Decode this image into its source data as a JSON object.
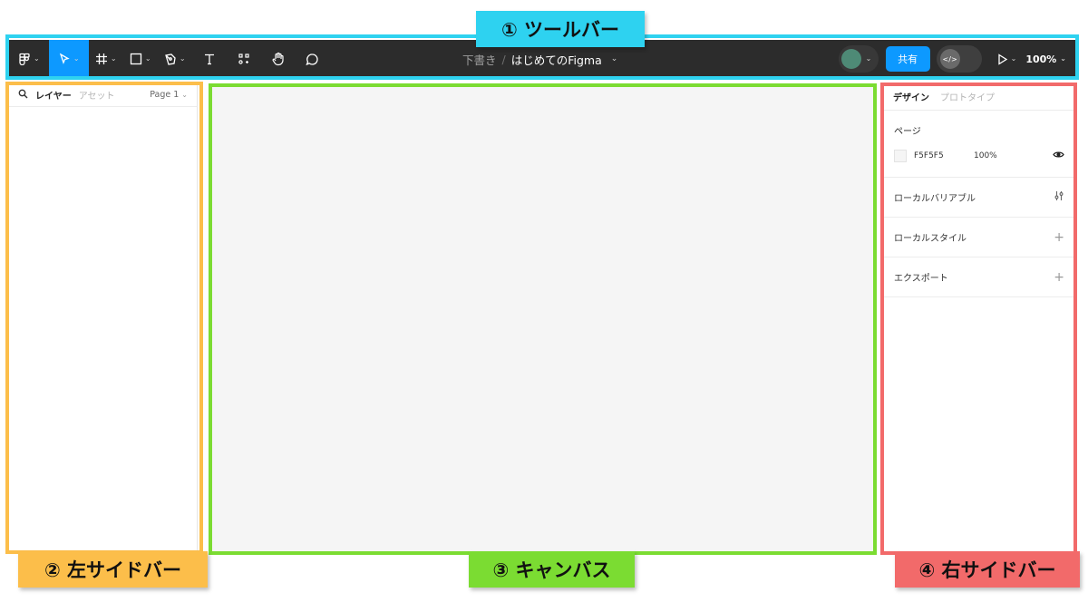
{
  "annotations": {
    "toolbar": "① ツールバー",
    "left_sidebar": "② 左サイドバー",
    "canvas": "③ キャンバス",
    "right_sidebar": "④ 右サイドバー",
    "colors": {
      "toolbar": "#2ed2f0",
      "left_sidebar": "#fcbe4a",
      "canvas": "#7bdc32",
      "right_sidebar": "#f26a6a"
    }
  },
  "toolbar": {
    "tools": [
      {
        "icon": "figma-menu-icon",
        "has_caret": true
      },
      {
        "icon": "move-cursor-icon",
        "has_caret": true,
        "active": true
      },
      {
        "icon": "frame-hash-icon",
        "has_caret": true
      },
      {
        "icon": "rectangle-icon",
        "has_caret": true
      },
      {
        "icon": "pen-icon",
        "has_caret": true
      },
      {
        "icon": "text-icon",
        "has_caret": false
      },
      {
        "icon": "resources-icon",
        "has_caret": false
      },
      {
        "icon": "hand-icon",
        "has_caret": false
      },
      {
        "icon": "comment-icon",
        "has_caret": false
      }
    ],
    "breadcrumb_draft": "下書き",
    "breadcrumb_separator": "/",
    "file_name": "はじめてのFigma",
    "avatar_color": "#4e8a76",
    "share_label": "共有",
    "dev_mode_icon": "</>",
    "zoom": "100%",
    "accent": "#0d99ff"
  },
  "left_sidebar": {
    "tab_layers": "レイヤー",
    "tab_assets": "アセット",
    "page_selector": "Page 1"
  },
  "canvas": {
    "background": "#f5f5f5"
  },
  "right_sidebar": {
    "tab_design": "デザイン",
    "tab_prototype": "プロトタイプ",
    "page_section_title": "ページ",
    "page_color_hex": "F5F5F5",
    "page_opacity": "100%",
    "local_variables": "ローカルバリアブル",
    "local_styles": "ローカルスタイル",
    "export": "エクスポート"
  }
}
